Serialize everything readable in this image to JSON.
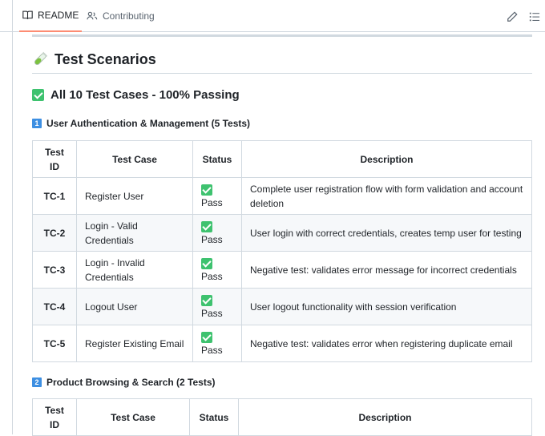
{
  "tabs": [
    {
      "label": "README",
      "icon": "book-icon",
      "active": true
    },
    {
      "label": "Contributing",
      "icon": "people-icon",
      "active": false
    }
  ],
  "toolbar": {
    "edit_icon": "pencil-icon",
    "toc_icon": "list-icon"
  },
  "colors": {
    "accent_tab": "#fd8c73",
    "check": "#3ec26f",
    "number_badge": "#3d8fe2"
  },
  "heading": {
    "emoji": "test-tube-icon",
    "title": "Test Scenarios"
  },
  "summary": {
    "icon": "checkmark-icon",
    "text": "All 10 Test Cases - 100% Passing"
  },
  "sections": [
    {
      "number": "1",
      "title": "User Authentication & Management (5 Tests)",
      "columns": [
        "Test ID",
        "Test Case",
        "Status",
        "Description"
      ],
      "rows": [
        {
          "id": "TC-1",
          "case": "Register User",
          "status": "Pass",
          "description": "Complete user registration flow with form validation and account deletion"
        },
        {
          "id": "TC-2",
          "case": "Login - Valid Credentials",
          "status": "Pass",
          "description": "User login with correct credentials, creates temp user for testing"
        },
        {
          "id": "TC-3",
          "case": "Login - Invalid Credentials",
          "status": "Pass",
          "description": "Negative test: validates error message for incorrect credentials"
        },
        {
          "id": "TC-4",
          "case": "Logout User",
          "status": "Pass",
          "description": "User logout functionality with session verification"
        },
        {
          "id": "TC-5",
          "case": "Register Existing Email",
          "status": "Pass",
          "description": "Negative test: validates error when registering duplicate email"
        }
      ]
    },
    {
      "number": "2",
      "title": "Product Browsing & Search (2 Tests)",
      "columns": [
        "Test ID",
        "Test Case",
        "Status",
        "Description"
      ],
      "rows": []
    }
  ]
}
